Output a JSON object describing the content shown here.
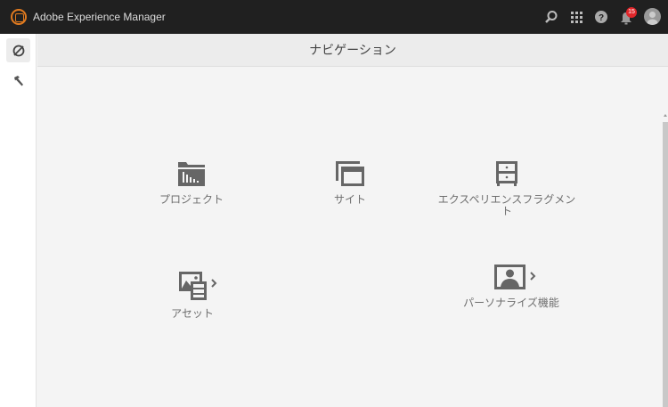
{
  "app": {
    "title": "Adobe Experience Manager",
    "notification_count": "15"
  },
  "page": {
    "title": "ナビゲーション"
  },
  "tiles": [
    {
      "label": "プロジェクト",
      "icon": "projects-icon"
    },
    {
      "label": "サイト",
      "icon": "sites-icon"
    },
    {
      "label": "エクスペリエンスフラグメント",
      "icon": "experience-fragments-icon"
    },
    {
      "label": "アセット",
      "icon": "assets-icon"
    },
    {
      "label": "パーソナライズ機能",
      "icon": "personalization-icon"
    }
  ],
  "colors": {
    "topbar": "#202020",
    "accent": "#e07a1f",
    "badge": "#e0262a"
  }
}
